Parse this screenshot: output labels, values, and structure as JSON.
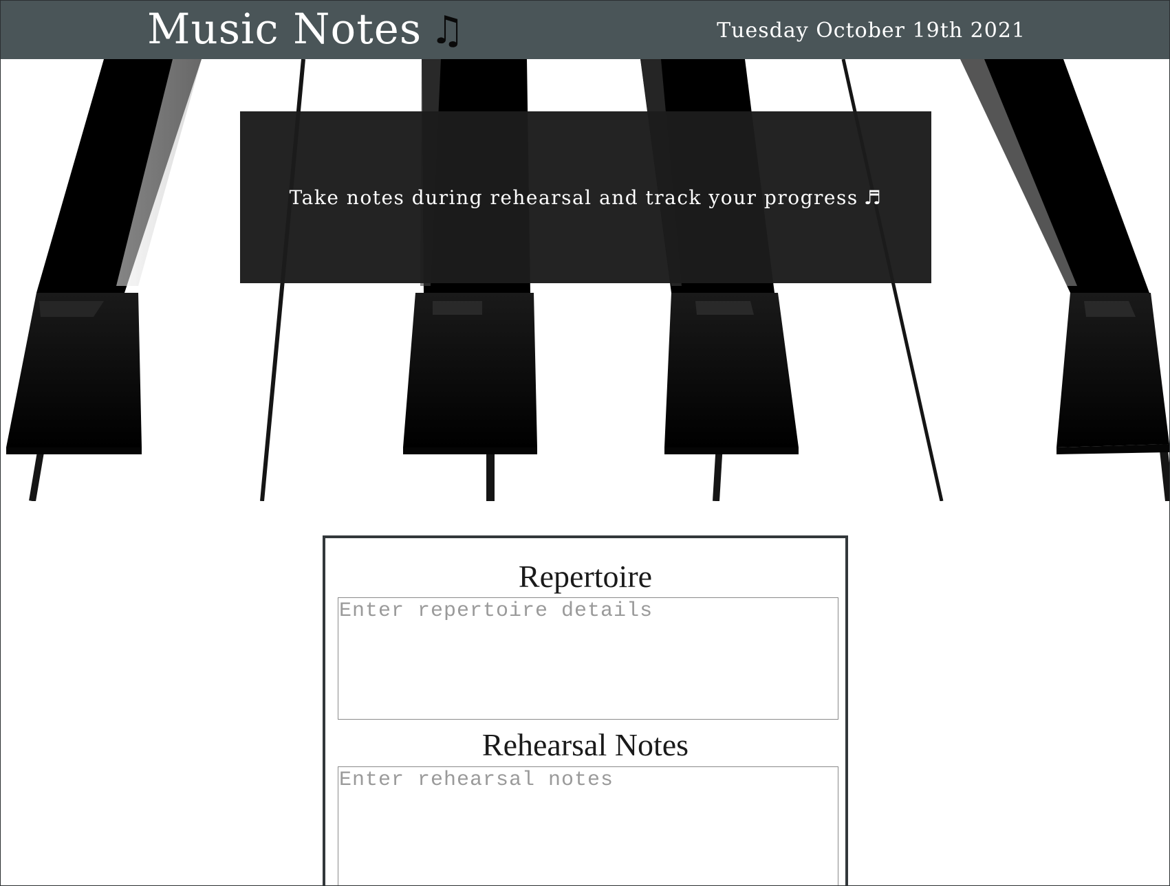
{
  "header": {
    "title": "Music Notes",
    "title_icon": "♫",
    "date": "Tuesday October 19th 2021"
  },
  "hero": {
    "background_image": "piano-keys",
    "tagline": "Take notes during rehearsal and track your progress",
    "tagline_icon": "♬"
  },
  "notes": {
    "repertoire": {
      "heading": "Repertoire",
      "placeholder": "Enter repertoire details",
      "value": ""
    },
    "rehearsal": {
      "heading": "Rehearsal Notes",
      "placeholder": "Enter rehearsal notes",
      "value": ""
    }
  },
  "colors": {
    "header_bg": "#4a5558",
    "tagline_bg": "#1c1c1c",
    "card_border": "#33383b"
  }
}
